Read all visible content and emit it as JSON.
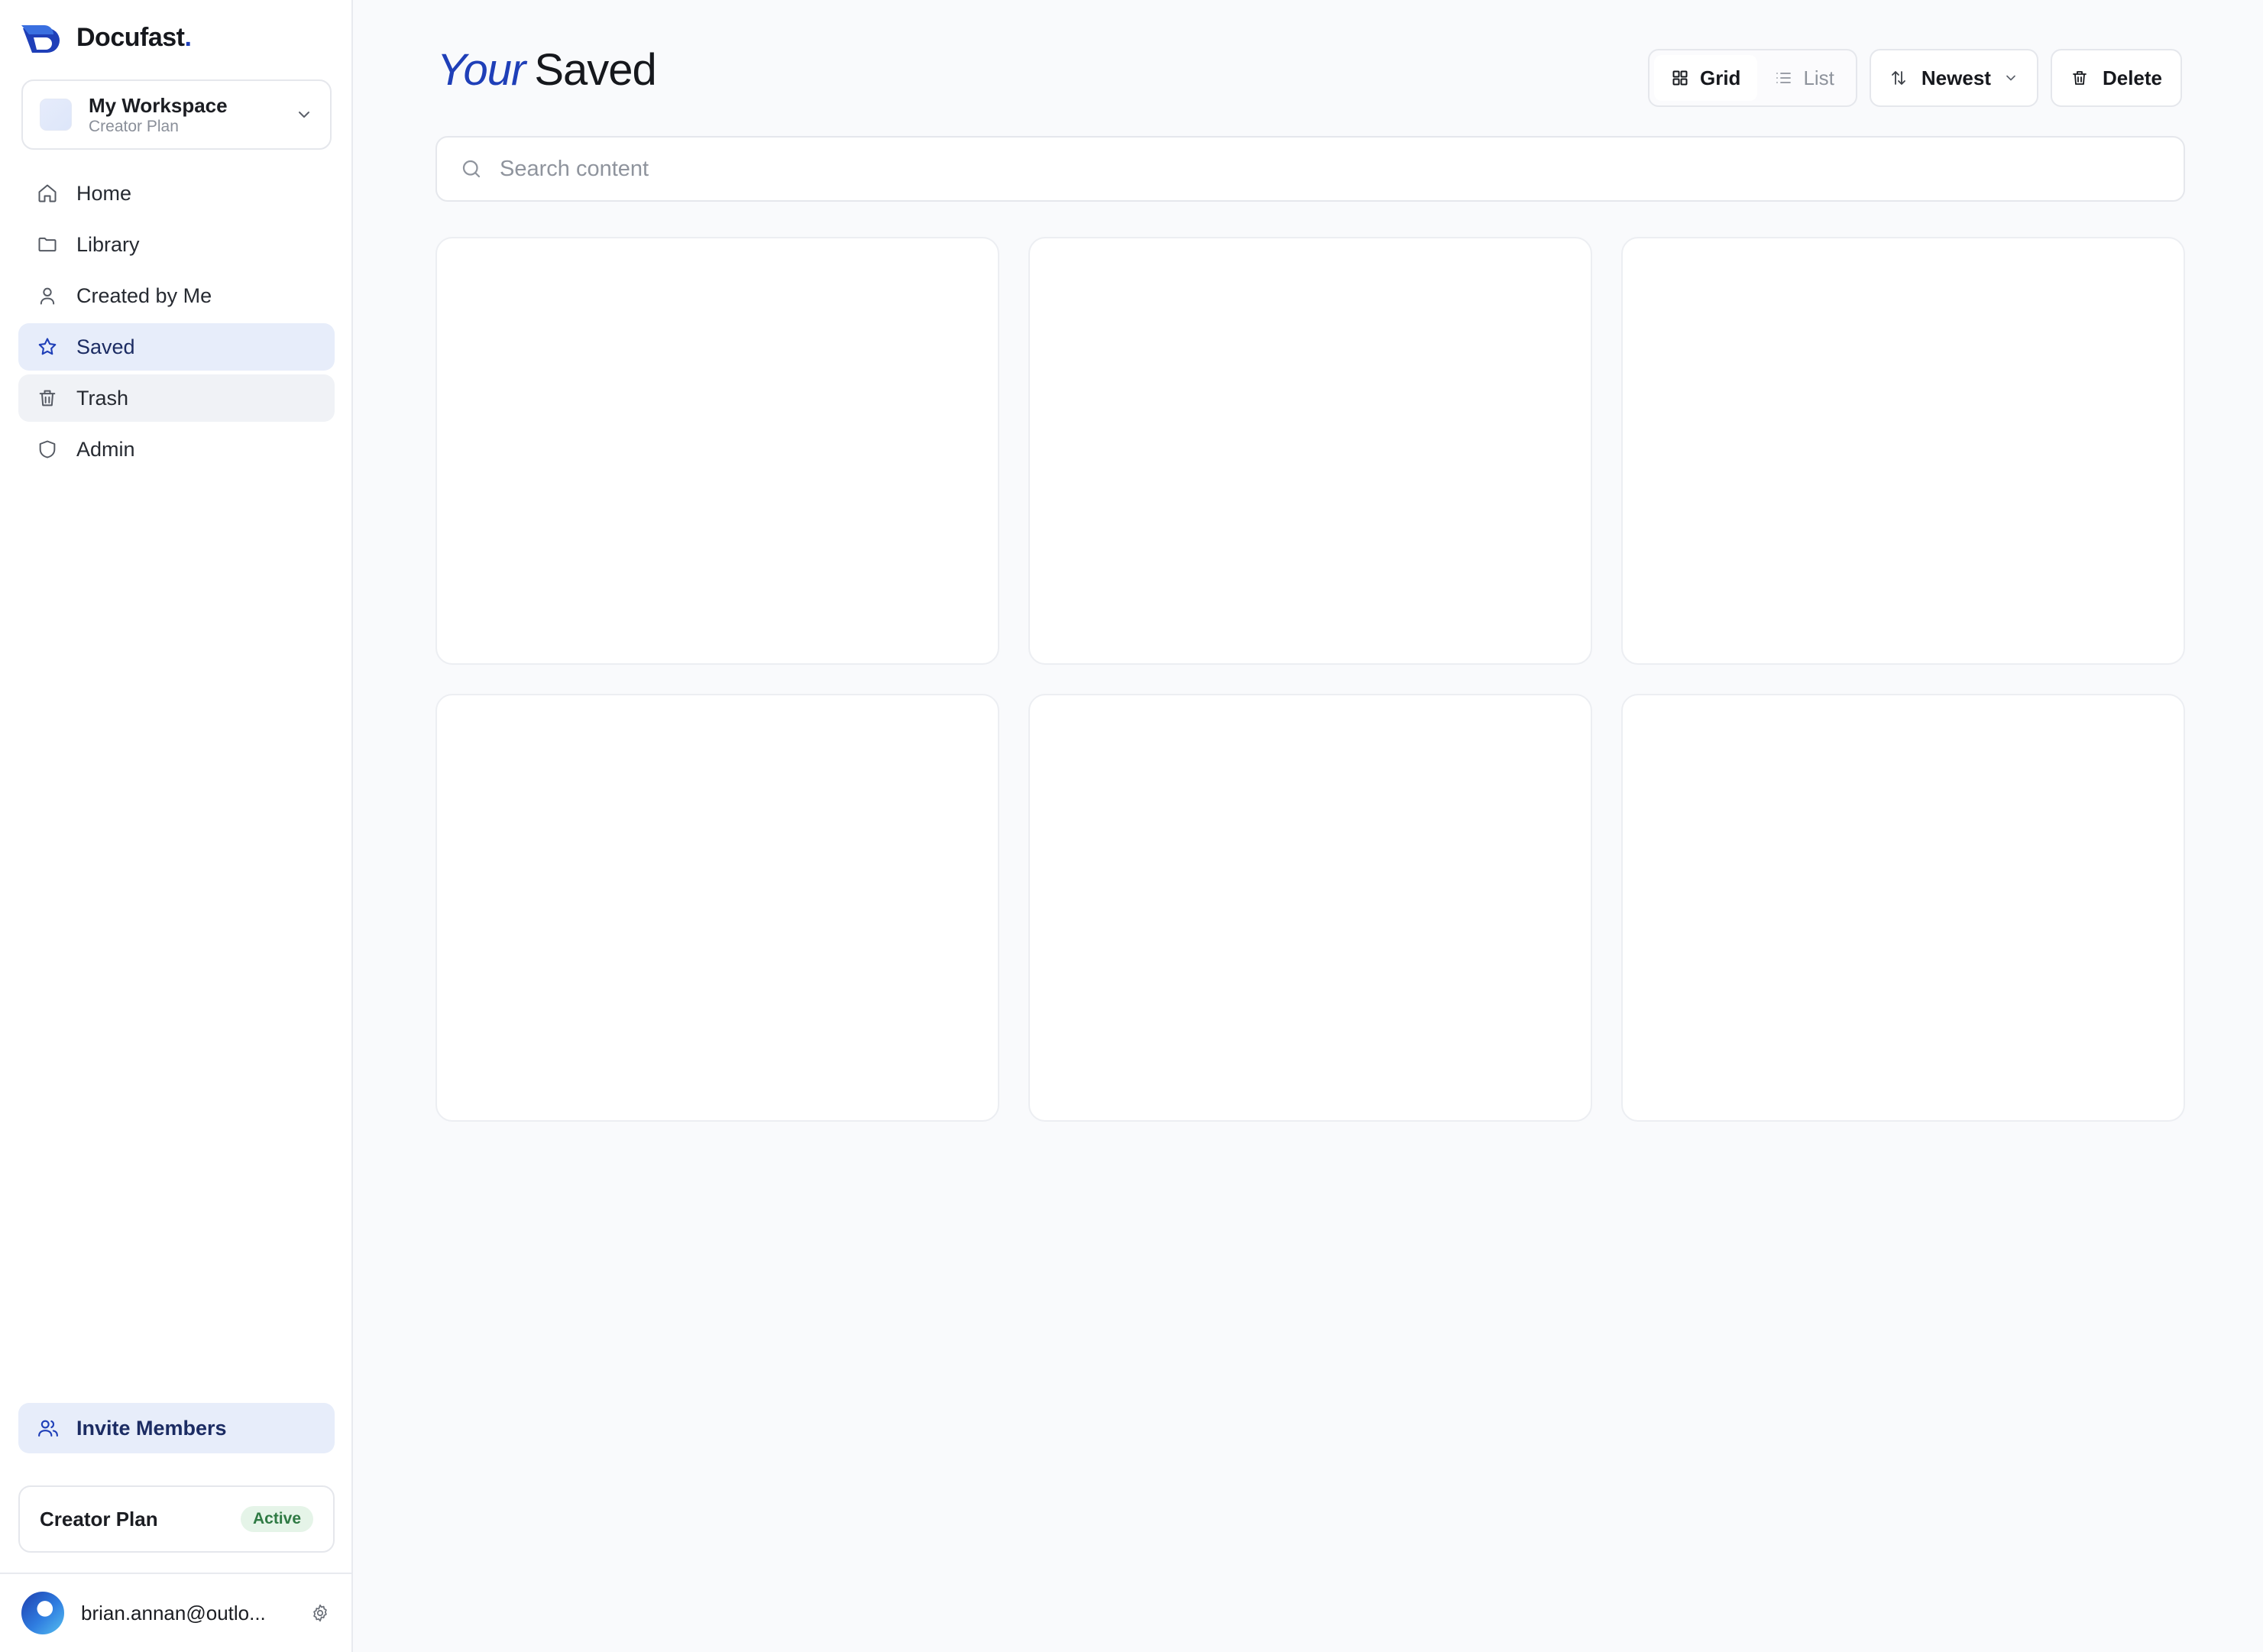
{
  "brand": {
    "name": "Docufast",
    "dot": "."
  },
  "workspace": {
    "name": "My Workspace",
    "plan": "Creator Plan"
  },
  "nav": {
    "items": [
      {
        "label": "Home",
        "icon": "home-icon"
      },
      {
        "label": "Library",
        "icon": "folder-icon"
      },
      {
        "label": "Created by Me",
        "icon": "user-icon"
      },
      {
        "label": "Saved",
        "icon": "star-icon",
        "state": "active"
      },
      {
        "label": "Trash",
        "icon": "trash-icon",
        "state": "hover"
      },
      {
        "label": "Admin",
        "icon": "shield-icon"
      }
    ]
  },
  "invite": {
    "label": "Invite Members",
    "icon": "users-icon"
  },
  "plan_card": {
    "name": "Creator Plan",
    "status": "Active"
  },
  "user": {
    "email": "brian.annan@outlo..."
  },
  "header": {
    "title_accent": "Your",
    "title": "Saved"
  },
  "toolbar": {
    "view_grid": "Grid",
    "view_list": "List",
    "view_selected": "Grid",
    "sort_label": "Newest",
    "delete_label": "Delete"
  },
  "search": {
    "placeholder": "Search content",
    "value": ""
  },
  "cards": {
    "count": 6
  },
  "colors": {
    "accent": "#1f3fb8",
    "active_bg": "#e7edfa",
    "badge_bg": "#e5f4e8",
    "badge_text": "#2f7a44",
    "page_bg": "#f9fafc"
  }
}
